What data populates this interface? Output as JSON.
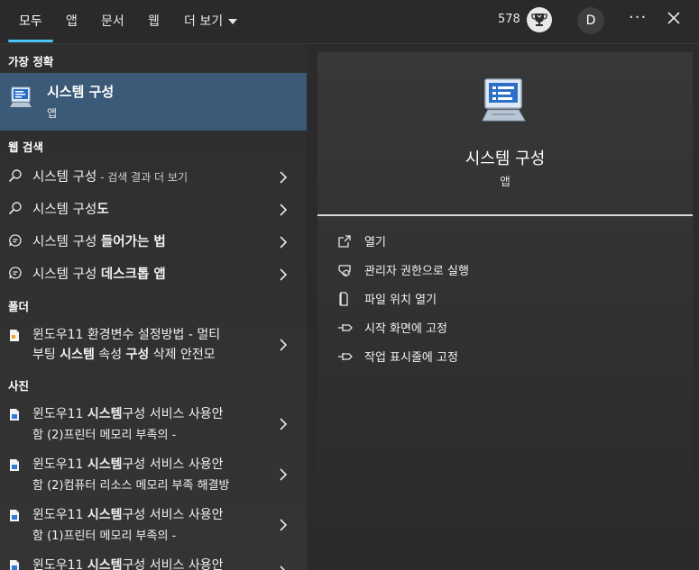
{
  "tabs": [
    {
      "label": "모두",
      "active": true
    },
    {
      "label": "앱"
    },
    {
      "label": "문서"
    },
    {
      "label": "웹"
    },
    {
      "label": "더 보기"
    }
  ],
  "header": {
    "points": "578",
    "avatar_initial": "D",
    "more": "···"
  },
  "sections": {
    "best": "가장 정확",
    "web": "웹 검색",
    "folder": "폴더",
    "photos": "사진"
  },
  "best_match": {
    "title": "시스템 구성",
    "subtitle": "앱"
  },
  "web_results": [
    {
      "plain": "시스템 구성",
      "suffix": " - 검색 결과 더 보기"
    },
    {
      "plain": "시스템 구성",
      "bold": "도"
    },
    {
      "plain": "시스템 구성 ",
      "bold": "들어가는 법"
    },
    {
      "plain": "시스템 구성 ",
      "bold": "데스크톱 앱"
    }
  ],
  "folder_result": {
    "line1": "윈도우11 환경변수 설정방법 - 멀티",
    "line2_a": "부팅 ",
    "line2_b": "시스템",
    "line2_c": " 속성 ",
    "line2_d": "구성",
    "line2_e": " 삭제 안전모"
  },
  "photo_results": [
    {
      "a": "윈도우11 ",
      "b": "시스템",
      "c": "구성",
      "d": " 서비스 사용안",
      "line2": "함 (2)프린터 메모리 부족의 -"
    },
    {
      "a": "윈도우11 ",
      "b": "시스템",
      "c": "구성",
      "d": " 서비스 사용안",
      "line2": "함 (2)컴퓨터 리소스 메모리 부족 해결방"
    },
    {
      "a": "윈도우11 ",
      "b": "시스템",
      "c": "구성",
      "d": " 서비스 사용안",
      "line2": "함 (1)프린터 메모리 부족의 -"
    },
    {
      "a": "윈도우11 ",
      "b": "시스템",
      "c": "구성",
      "d": " 서비스 사용안",
      "line2": ""
    }
  ],
  "preview": {
    "title": "시스템 구성",
    "subtitle": "앱"
  },
  "actions": [
    {
      "label": "열기",
      "icon": "open-icon"
    },
    {
      "label": "관리자 권한으로 실행",
      "icon": "shield-icon"
    },
    {
      "label": "파일 위치 열기",
      "icon": "folder-icon"
    },
    {
      "label": "시작 화면에 고정",
      "icon": "pin-icon"
    },
    {
      "label": "작업 표시줄에 고정",
      "icon": "pin-icon"
    }
  ],
  "colors": {
    "accent": "#4cc2ff",
    "selected": "#3a5a78",
    "background": "#2b2b2b"
  }
}
